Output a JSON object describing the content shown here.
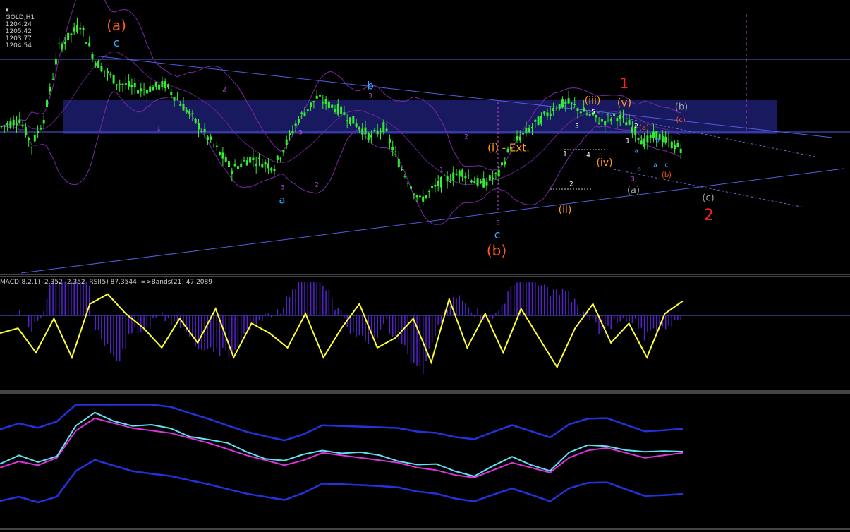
{
  "header": {
    "symbol": "GOLD,H1",
    "open": "1204.24",
    "high": "1205.42",
    "low": "1203.77",
    "close": "1204.54"
  },
  "macd_panel": {
    "caption": "MACD(8,2,1) -2.352 -2.352  RSI(5) 87.3544  =>Bands(21) 47.2089"
  },
  "colors": {
    "background": "#000000",
    "candle": "#33ee33",
    "channel": "#4f5fe0",
    "zone": "#1c1c6a",
    "bands": "#7a2aa8",
    "rsi": "#ffff33",
    "macd_hist": "#5522cc",
    "osc": "#5ee3f0",
    "osc_band": "#2233dd",
    "osc_ma": "#dd33dd",
    "wave_orange": "#ff5a1f",
    "wave_blue": "#33aaff",
    "wave_red": "#ff2020",
    "wave_gold": "#ff9a1f",
    "wave_purple": "#b050e0",
    "wave_grey": "#a0a0a0"
  },
  "wave_labels": [
    {
      "text": "(a)",
      "color": "#ff5a1f",
      "size": 20
    },
    {
      "text": "c",
      "color": "#33aaff",
      "size": 16
    },
    {
      "text": "b",
      "color": "#33aaff",
      "size": 15
    },
    {
      "text": "a",
      "color": "#33aaff",
      "size": 15
    },
    {
      "text": "c",
      "color": "#33aaff",
      "size": 16
    },
    {
      "text": "(b)",
      "color": "#ff5a1f",
      "size": 20
    },
    {
      "text": "(i) - Ext.",
      "color": "#ff9a1f",
      "size": 15
    },
    {
      "text": "(ii)",
      "color": "#ff9a1f",
      "size": 14
    },
    {
      "text": "(iii)",
      "color": "#ff9a1f",
      "size": 14
    },
    {
      "text": "(iv)",
      "color": "#ff9a1f",
      "size": 14
    },
    {
      "text": "(v)",
      "color": "#ff9a1f",
      "size": 15
    },
    {
      "text": "1",
      "color": "#ff2020",
      "size": 20
    },
    {
      "text": "2",
      "color": "#ff2020",
      "size": 22
    },
    {
      "text": "(b)",
      "color": "#a0a0a0",
      "size": 13
    },
    {
      "text": "(a)",
      "color": "#a0a0a0",
      "size": 13
    },
    {
      "text": "(c)",
      "color": "#a0a0a0",
      "size": 13
    },
    {
      "text": "(c)",
      "color": "#ff5a1f",
      "size": 10
    },
    {
      "text": "(a)",
      "color": "#ff5a1f",
      "size": 10
    },
    {
      "text": "(b)",
      "color": "#ff5a1f",
      "size": 10
    },
    {
      "text": "1",
      "color": "#b050e0",
      "size": 9
    },
    {
      "text": "2",
      "color": "#b050e0",
      "size": 9
    },
    {
      "text": "3",
      "color": "#b050e0",
      "size": 9
    },
    {
      "text": "3",
      "color": "#b050e0",
      "size": 9
    },
    {
      "text": "2",
      "color": "#b050e0",
      "size": 9
    },
    {
      "text": "1",
      "color": "#b050e0",
      "size": 9
    },
    {
      "text": "2",
      "color": "#b050e0",
      "size": 9
    },
    {
      "text": "3",
      "color": "#b050e0",
      "size": 9
    },
    {
      "text": "3",
      "color": "#b050e0",
      "size": 9
    },
    {
      "text": "1",
      "color": "#ffffff",
      "size": 9
    },
    {
      "text": "2",
      "color": "#ffffff",
      "size": 9
    },
    {
      "text": "3",
      "color": "#ffffff",
      "size": 9
    },
    {
      "text": "4",
      "color": "#ffffff",
      "size": 9
    },
    {
      "text": "5",
      "color": "#ffffff",
      "size": 9
    },
    {
      "text": "1",
      "color": "#ffffff",
      "size": 9
    },
    {
      "text": "2",
      "color": "#ffffff",
      "size": 9
    },
    {
      "text": "3",
      "color": "#b050e0",
      "size": 9
    },
    {
      "text": "a",
      "color": "#33aaff",
      "size": 9
    },
    {
      "text": "b",
      "color": "#33aaff",
      "size": 9
    },
    {
      "text": "c",
      "color": "#33aaff",
      "size": 9
    },
    {
      "text": "a",
      "color": "#33aaff",
      "size": 9
    },
    {
      "text": "b",
      "color": "#33aaff",
      "size": 9
    },
    {
      "text": "c",
      "color": "#33aaff",
      "size": 9
    }
  ],
  "chart_data": {
    "type": "candlestick",
    "symbol": "GOLD",
    "timeframe": "H1",
    "series": [
      {
        "name": "price",
        "trend": [
          [
            0,
            55
          ],
          [
            6,
            58
          ],
          [
            10,
            48
          ],
          [
            14,
            58
          ],
          [
            19,
            85
          ],
          [
            26,
            94
          ],
          [
            31,
            80
          ],
          [
            38,
            72
          ],
          [
            46,
            69
          ],
          [
            54,
            71
          ],
          [
            62,
            60
          ],
          [
            70,
            48
          ],
          [
            76,
            39
          ],
          [
            82,
            43
          ],
          [
            90,
            40
          ],
          [
            98,
            58
          ],
          [
            104,
            66
          ],
          [
            112,
            61
          ],
          [
            122,
            51
          ],
          [
            126,
            55
          ],
          [
            132,
            39
          ],
          [
            138,
            27
          ],
          [
            145,
            34
          ],
          [
            152,
            38
          ],
          [
            158,
            33
          ],
          [
            164,
            37
          ],
          [
            168,
            48
          ],
          [
            176,
            56
          ],
          [
            183,
            63
          ],
          [
            187,
            64
          ],
          [
            193,
            60
          ],
          [
            198,
            57
          ],
          [
            203,
            59
          ],
          [
            207,
            56
          ],
          [
            212,
            49
          ],
          [
            216,
            52
          ],
          [
            220,
            49
          ],
          [
            224,
            47
          ]
        ]
      },
      {
        "name": "rsi",
        "values": [
          55,
          60,
          35,
          70,
          30,
          85,
          95,
          75,
          60,
          40,
          70,
          45,
          80,
          30,
          65,
          55,
          40,
          75,
          30,
          60,
          85,
          40,
          50,
          70,
          25,
          90,
          40,
          75,
          35,
          80,
          50,
          20,
          60,
          85,
          45,
          65,
          30,
          75,
          88
        ]
      },
      {
        "name": "osc",
        "values": [
          50,
          55,
          52,
          58,
          80,
          90,
          86,
          82,
          80,
          78,
          74,
          70,
          65,
          60,
          56,
          52,
          56,
          62,
          60,
          58,
          56,
          54,
          50,
          48,
          44,
          42,
          48,
          54,
          50,
          46,
          58,
          64,
          66,
          62,
          58,
          60,
          62
        ]
      }
    ]
  }
}
